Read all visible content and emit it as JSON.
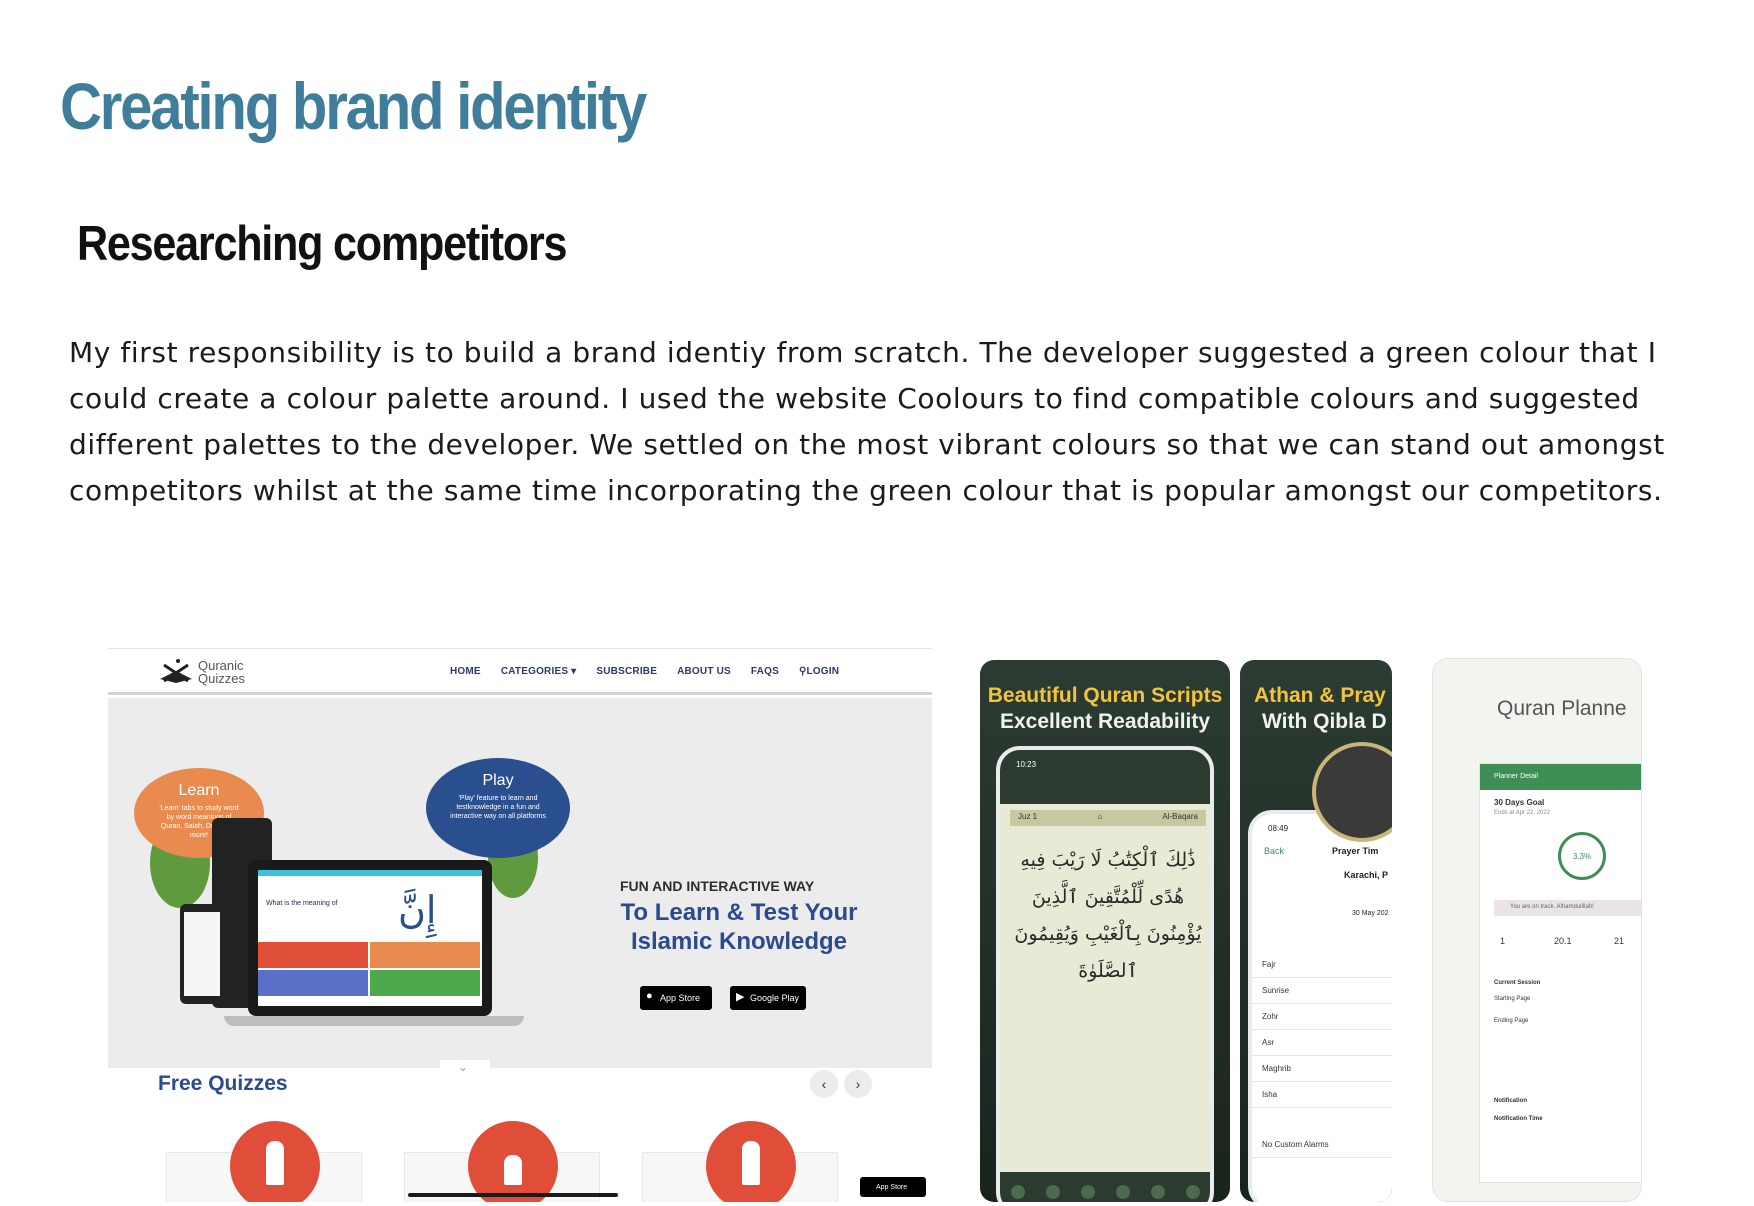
{
  "page": {
    "title": "Creating brand identity",
    "section_title": "Researching competitors",
    "intro": "My first responsibility is to build a brand identiy from scratch. The developer suggested a green colour that I could create a colour palette around. I used the website Coolours to find compatible colours and suggested different palettes to the developer. We settled on the most vibrant colours so that we can stand out amongst competitors whilst at the same time incorporating the green colour that is popular amongst our competitors."
  },
  "site": {
    "logo_line1": "Quranic",
    "logo_line2": "Quizzes",
    "nav": [
      "HOME",
      "CATEGORIES ▾",
      "SUBSCRIBE",
      "ABOUT US",
      "FAQS",
      "LOGIN"
    ],
    "learn_title": "Learn",
    "learn_body": "'Learn' tabs to study word by word meanings of Quran, Salah, Dua's and more!",
    "play_title": "Play",
    "play_body": "'Play' feature to learn and testknowledge in a fun and interactive way on all platforms",
    "quiz_question": "What is the meaning of",
    "quiz_arabic": "إِنَّ",
    "hero_sub": "FUN AND INTERACTIVE WAY",
    "hero_line1": "To Learn & Test  Your",
    "hero_line2": "Islamic Knowledge",
    "app_store": "App Store",
    "google_play": "Google Play",
    "free_quizzes": "Free Quizzes",
    "prev": "‹",
    "next": "›",
    "mini_store": "App Store"
  },
  "quran_app": {
    "title_line1": "Beautiful Quran Scripts",
    "title_line2": "Excellent Readability",
    "time": "10:23",
    "juz": "Juz 1",
    "surah": "Al-Baqara",
    "text": "ذَٰلِكَ ٱلْكِتَٰبُ لَا رَيْبَ فِيهِ هُدًى لِّلْمُتَّقِينَ ٱلَّذِينَ يُؤْمِنُونَ بِٱلْغَيْبِ وَيُقِيمُونَ ٱلصَّلَوٰةَ"
  },
  "athan_app": {
    "title_line1": "Athan & Pray",
    "title_line2": "With Qibla D",
    "time": "08:49",
    "back": "Back",
    "header": "Prayer Tim",
    "city": "Karachi, P",
    "date": "30 May 202",
    "prayers": [
      "Fajr",
      "Sunrise",
      "Zohr",
      "Asr",
      "Maghrib",
      "Isha"
    ],
    "alarms": "No Custom Alarms"
  },
  "planner_app": {
    "title": "Quran Planne",
    "header": "Planner Detail",
    "goal": "30 Days Goal",
    "ends": "Ends at Apr 22, 2022",
    "percent": "3.3%",
    "banner": "You are on track. Alhamdulillah!",
    "stat1": "1",
    "stat2": "20.1",
    "stat3": "21",
    "current_session": "Current Session",
    "starting_page": "Starting Page",
    "ending_page": "Ending Page",
    "notification": "Notification",
    "notification_time": "Notification Time"
  },
  "colors": {
    "title": "#3f7d9a",
    "brand_green": "#3e8e55",
    "quiz_red": "#e04e3a"
  }
}
